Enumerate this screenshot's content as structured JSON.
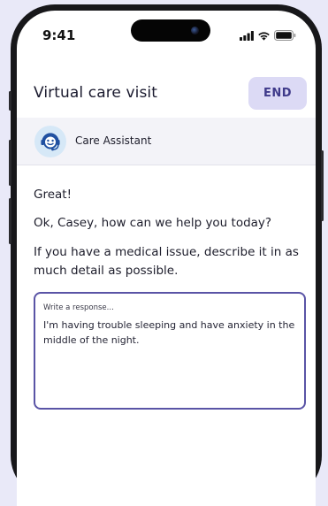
{
  "status_bar": {
    "time": "9:41"
  },
  "header": {
    "title": "Virtual care visit",
    "end_label": "END"
  },
  "assistant": {
    "name": "Care Assistant"
  },
  "messages": [
    "Great!",
    "Ok, Casey, how can we help you today?",
    "If you have a medical issue, describe it in as much detail as possible."
  ],
  "response": {
    "placeholder": "Write a response...",
    "value": "I'm having trouble sleeping and have anxiety in the middle of the night."
  },
  "colors": {
    "background": "#e9e9f8",
    "accent": "#5a54a6",
    "end_button_bg": "#dcdaf5",
    "end_button_text": "#3f3a8a",
    "assistant_bar": "#f3f3f8"
  }
}
